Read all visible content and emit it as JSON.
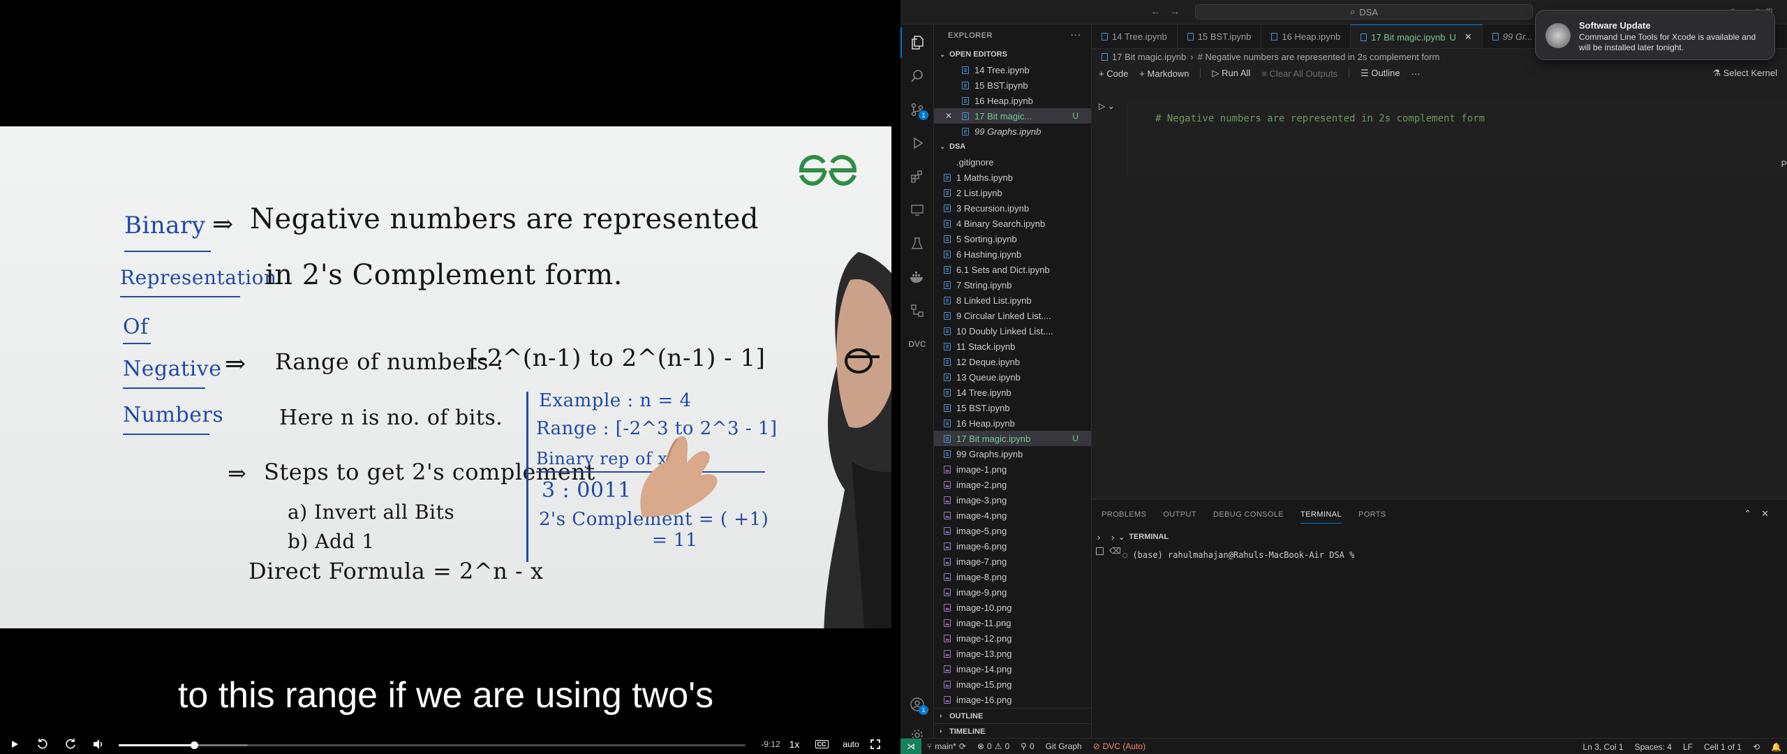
{
  "video": {
    "whiteboard": {
      "left_labels": [
        "Binary",
        "Representation",
        "Of",
        "Negative",
        "Numbers"
      ],
      "line1": "Negative numbers are represented",
      "line2": "in 2's Complement form.",
      "range_label": "Range of numbers :",
      "range_expr": "[-2^(n-1) to 2^(n-1) - 1]",
      "here_n": "Here n is no. of bits.",
      "steps": "Steps to get 2's complement",
      "step_a": "a) Invert all Bits",
      "step_b": "b) Add 1",
      "direct": "Direct Formula = 2^n - x",
      "example": "Example : n = 4",
      "range_ex": "Range : [-2^3 to 2^3 - 1]",
      "binary_sub": "Binary rep of x = -3",
      "three": "3 : 0011",
      "twos": "2's Complement = (    +1)",
      "eq": "= 11"
    },
    "subtitle": "to this range if we are using two's",
    "time_remaining": "-9:12",
    "speed": "1x",
    "cc_label": "CC",
    "quality": "auto",
    "progress": 0.12,
    "buffered": 0.206
  },
  "vscode": {
    "search_text": "DSA",
    "explorer_title": "EXPLORER",
    "open_editors_title": "OPEN EDITORS",
    "open_editors": [
      {
        "label": "14 Tree.ipynb",
        "modified": false,
        "italic": false,
        "selected": false
      },
      {
        "label": "15 BST.ipynb",
        "modified": false,
        "italic": false,
        "selected": false
      },
      {
        "label": "16 Heap.ipynb",
        "modified": false,
        "italic": false,
        "selected": false
      },
      {
        "label": "17 Bit magic...",
        "modified": true,
        "italic": false,
        "selected": true,
        "badge": "U"
      },
      {
        "label": "99 Graphs.ipynb",
        "modified": false,
        "italic": true,
        "selected": false
      }
    ],
    "folder_title": "DSA",
    "files": [
      {
        "label": ".gitignore",
        "kind": "git"
      },
      {
        "label": "1 Maths.ipynb",
        "kind": "nb"
      },
      {
        "label": "2 List.ipynb",
        "kind": "nb"
      },
      {
        "label": "3 Recursion.ipynb",
        "kind": "nb"
      },
      {
        "label": "4 Binary Search.ipynb",
        "kind": "nb"
      },
      {
        "label": "5 Sorting.ipynb",
        "kind": "nb"
      },
      {
        "label": "6 Hashing.ipynb",
        "kind": "nb"
      },
      {
        "label": "6.1 Sets and Dict.ipynb",
        "kind": "nb"
      },
      {
        "label": "7 String.ipynb",
        "kind": "nb"
      },
      {
        "label": "8 Linked List.ipynb",
        "kind": "nb"
      },
      {
        "label": "9 Circular Linked List....",
        "kind": "nb"
      },
      {
        "label": "10 Doubly Linked List....",
        "kind": "nb"
      },
      {
        "label": "11 Stack.ipynb",
        "kind": "nb"
      },
      {
        "label": "12 Deque.ipynb",
        "kind": "nb"
      },
      {
        "label": "13 Queue.ipynb",
        "kind": "nb"
      },
      {
        "label": "14 Tree.ipynb",
        "kind": "nb"
      },
      {
        "label": "15 BST.ipynb",
        "kind": "nb"
      },
      {
        "label": "16 Heap.ipynb",
        "kind": "nb"
      },
      {
        "label": "17 Bit magic.ipynb",
        "kind": "nb",
        "modified": true,
        "selected": true,
        "badge": "U"
      },
      {
        "label": "99 Graphs.ipynb",
        "kind": "nb"
      },
      {
        "label": "image-1.png",
        "kind": "img"
      },
      {
        "label": "image-2.png",
        "kind": "img"
      },
      {
        "label": "image-3.png",
        "kind": "img"
      },
      {
        "label": "image-4.png",
        "kind": "img"
      },
      {
        "label": "image-5.png",
        "kind": "img"
      },
      {
        "label": "image-6.png",
        "kind": "img"
      },
      {
        "label": "image-7.png",
        "kind": "img"
      },
      {
        "label": "image-8.png",
        "kind": "img"
      },
      {
        "label": "image-9.png",
        "kind": "img"
      },
      {
        "label": "image-10.png",
        "kind": "img"
      },
      {
        "label": "image-11.png",
        "kind": "img"
      },
      {
        "label": "image-12.png",
        "kind": "img"
      },
      {
        "label": "image-13.png",
        "kind": "img"
      },
      {
        "label": "image-14.png",
        "kind": "img"
      },
      {
        "label": "image-15.png",
        "kind": "img"
      },
      {
        "label": "image-16.png",
        "kind": "img"
      }
    ],
    "outline_title": "OUTLINE",
    "timeline_title": "TIMELINE",
    "tabs": [
      {
        "label": "14 Tree.ipynb",
        "active": false,
        "italic": false
      },
      {
        "label": "15 BST.ipynb",
        "active": false,
        "italic": false
      },
      {
        "label": "16 Heap.ipynb",
        "active": false,
        "italic": false
      },
      {
        "label": "17 Bit magic.ipynb",
        "active": true,
        "italic": false,
        "badge": "U"
      },
      {
        "label": "99 Gr...",
        "active": false,
        "italic": true
      }
    ],
    "breadcrumb": [
      "17 Bit magic.ipynb",
      "# Negative numbers are represented in 2s complement form"
    ],
    "toolbar": {
      "code": "Code",
      "markdown": "Markdown",
      "run_all": "Run All",
      "clear_outputs": "Clear All Outputs",
      "outline": "Outline",
      "select_kernel": "Select Kernel"
    },
    "cell": {
      "code": "# Negative numbers are represented in 2s complement form",
      "language": "Python"
    },
    "panel_tabs": [
      "PROBLEMS",
      "OUTPUT",
      "DEBUG CONSOLE",
      "TERMINAL",
      "PORTS"
    ],
    "panel_active": "TERMINAL",
    "terminal_title": "TERMINAL",
    "terminal_line": "(base) rahulmahajan@Rahuls-MacBook-Air DSA %",
    "status": {
      "branch": "main*",
      "errors": "0",
      "warnings": "0",
      "ports": "0",
      "git_graph": "Git Graph",
      "dvc": "DVC (Auto)",
      "position": "Ln 3, Col 1",
      "spaces": "Spaces: 4",
      "eol": "LF",
      "cell": "Cell 1 of 1"
    },
    "badges": {
      "scm": "1",
      "accounts": "1"
    }
  },
  "notification": {
    "title": "Software Update",
    "body": "Command Line Tools for Xcode is available and will be installed later tonight."
  }
}
